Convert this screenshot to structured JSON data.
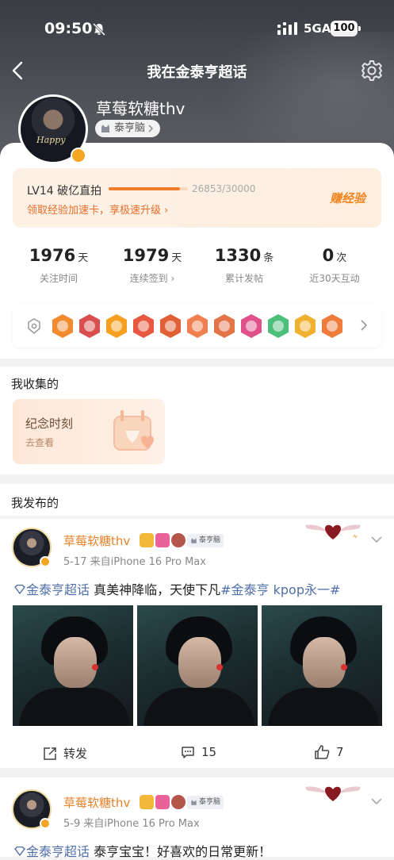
{
  "status_bar": {
    "time": "09:50",
    "network": "5GA",
    "battery": "100"
  },
  "nav": {
    "title": "我在金泰亨超话"
  },
  "profile": {
    "name": "草莓软糖thv",
    "tag": "泰亨脑",
    "avatar_text": "Happy"
  },
  "level": {
    "title": "LV14 破亿直拍",
    "progress_text": "26853/30000",
    "progress": 0.895,
    "sub": "领取经验加速卡，享极速升级",
    "earn_label": "赚经验"
  },
  "stats": [
    {
      "value": "1976",
      "unit": "天",
      "label": "关注时间"
    },
    {
      "value": "1979",
      "unit": "天",
      "label": "连续签到"
    },
    {
      "value": "1330",
      "unit": "条",
      "label": "累计发帖"
    },
    {
      "value": "0",
      "unit": "次",
      "label": "近30天互动"
    }
  ],
  "badge_colors": [
    "#f28a2f",
    "#d94f4f",
    "#f5a020",
    "#e8573f",
    "#e26035",
    "#f08050",
    "#e3744a",
    "#e0508a",
    "#4cbf7a",
    "#f0b030",
    "#f07c3c"
  ],
  "collect": {
    "title": "我收集的",
    "card_title": "纪念时刻",
    "card_sub": "去查看"
  },
  "posts_section": {
    "title": "我发布的"
  },
  "posts": [
    {
      "name": "草莓软糖thv",
      "tag": "泰亨脑",
      "meta": "5-17  来自iPhone 16 Pro Max",
      "topic": "金泰亨超话",
      "body": " 真美神降临，天使下凡",
      "hashtag": "#金泰亨 kpop永一#",
      "actions": {
        "repost": "转发",
        "comments": "15",
        "likes": "7"
      }
    },
    {
      "name": "草莓软糖thv",
      "tag": "泰亨脑",
      "meta": "5-9  来自iPhone 16 Pro Max",
      "topic": "金泰亨超话",
      "body": " 泰亨宝宝！好喜欢的日常更新！"
    }
  ]
}
